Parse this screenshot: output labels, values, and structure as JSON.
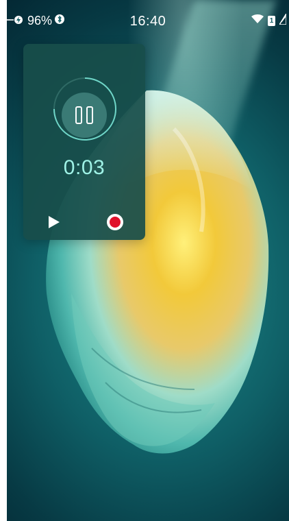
{
  "status_bar": {
    "battery_percent": "96%",
    "time": "16:40",
    "sim_number": "1",
    "icons": [
      "usb-charging-icon",
      "bluetooth-icon",
      "wifi-icon",
      "sim-icon",
      "signal-icon"
    ]
  },
  "recorder": {
    "elapsed_time": "0:03",
    "state": "recording",
    "controls": [
      "pause",
      "play",
      "record"
    ],
    "colors": {
      "panel": "#184e4a",
      "timer_text": "#9ff2e6",
      "record_dot": "#e0102a"
    }
  },
  "wallpaper": {
    "subject": "crystal",
    "colors": [
      "#0f5f66",
      "#f0c030",
      "#7fe0d0"
    ]
  }
}
